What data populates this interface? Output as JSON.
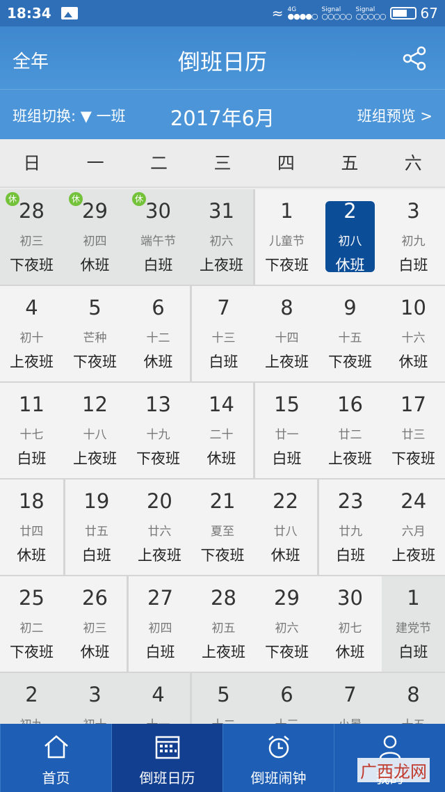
{
  "status_bar": {
    "time": "18:34",
    "network": "4G",
    "signal1": "Signal",
    "signal2": "Signal",
    "battery": "67"
  },
  "header": {
    "year_label": "全年",
    "title": "倒班日历"
  },
  "subheader": {
    "switch_label": "班组切换:",
    "team_arrow": "▼",
    "team": "一班",
    "month": "2017年6月",
    "preview_label": "班组预览",
    "preview_arrow": ">"
  },
  "weekdays": [
    "日",
    "一",
    "二",
    "三",
    "四",
    "五",
    "六"
  ],
  "weeks": [
    [
      {
        "day": "28",
        "lunar": "初三",
        "shift": "下夜班",
        "badge": "休",
        "gray": true
      },
      {
        "day": "29",
        "lunar": "初四",
        "shift": "休班",
        "badge": "休",
        "gray": true
      },
      {
        "day": "30",
        "lunar": "端午节",
        "shift": "白班",
        "badge": "休",
        "gray": true
      },
      {
        "day": "31",
        "lunar": "初六",
        "shift": "上夜班",
        "badge": "",
        "gray": true
      },
      {
        "day": "1",
        "lunar": "儿童节",
        "shift": "下夜班",
        "badge": ""
      },
      {
        "day": "2",
        "lunar": "初八",
        "shift": "休班",
        "badge": "",
        "selected": true
      },
      {
        "day": "3",
        "lunar": "初九",
        "shift": "白班",
        "badge": ""
      }
    ],
    [
      {
        "day": "4",
        "lunar": "初十",
        "shift": "上夜班"
      },
      {
        "day": "5",
        "lunar": "芒种",
        "shift": "下夜班"
      },
      {
        "day": "6",
        "lunar": "十二",
        "shift": "休班"
      },
      {
        "day": "7",
        "lunar": "十三",
        "shift": "白班"
      },
      {
        "day": "8",
        "lunar": "十四",
        "shift": "上夜班"
      },
      {
        "day": "9",
        "lunar": "十五",
        "shift": "下夜班"
      },
      {
        "day": "10",
        "lunar": "十六",
        "shift": "休班"
      }
    ],
    [
      {
        "day": "11",
        "lunar": "十七",
        "shift": "白班"
      },
      {
        "day": "12",
        "lunar": "十八",
        "shift": "上夜班"
      },
      {
        "day": "13",
        "lunar": "十九",
        "shift": "下夜班"
      },
      {
        "day": "14",
        "lunar": "二十",
        "shift": "休班"
      },
      {
        "day": "15",
        "lunar": "廿一",
        "shift": "白班"
      },
      {
        "day": "16",
        "lunar": "廿二",
        "shift": "上夜班"
      },
      {
        "day": "17",
        "lunar": "廿三",
        "shift": "下夜班"
      }
    ],
    [
      {
        "day": "18",
        "lunar": "廿四",
        "shift": "休班"
      },
      {
        "day": "19",
        "lunar": "廿五",
        "shift": "白班"
      },
      {
        "day": "20",
        "lunar": "廿六",
        "shift": "上夜班"
      },
      {
        "day": "21",
        "lunar": "夏至",
        "shift": "下夜班"
      },
      {
        "day": "22",
        "lunar": "廿八",
        "shift": "休班"
      },
      {
        "day": "23",
        "lunar": "廿九",
        "shift": "白班"
      },
      {
        "day": "24",
        "lunar": "六月",
        "shift": "上夜班"
      }
    ],
    [
      {
        "day": "25",
        "lunar": "初二",
        "shift": "下夜班"
      },
      {
        "day": "26",
        "lunar": "初三",
        "shift": "休班"
      },
      {
        "day": "27",
        "lunar": "初四",
        "shift": "白班"
      },
      {
        "day": "28",
        "lunar": "初五",
        "shift": "上夜班"
      },
      {
        "day": "29",
        "lunar": "初六",
        "shift": "下夜班"
      },
      {
        "day": "30",
        "lunar": "初七",
        "shift": "休班"
      },
      {
        "day": "1",
        "lunar": "建党节",
        "shift": "白班",
        "gray": true
      }
    ],
    [
      {
        "day": "2",
        "lunar": "初九",
        "shift": "",
        "gray": true
      },
      {
        "day": "3",
        "lunar": "初十",
        "shift": "",
        "gray": true
      },
      {
        "day": "4",
        "lunar": "十一",
        "shift": "",
        "gray": true
      },
      {
        "day": "5",
        "lunar": "十二",
        "shift": "",
        "gray": true
      },
      {
        "day": "6",
        "lunar": "十三",
        "shift": "",
        "gray": true
      },
      {
        "day": "7",
        "lunar": "小暑",
        "shift": "",
        "gray": true
      },
      {
        "day": "8",
        "lunar": "十五",
        "shift": "",
        "gray": true
      }
    ]
  ],
  "tabs": [
    {
      "label": "首页",
      "icon": "home-icon"
    },
    {
      "label": "倒班日历",
      "icon": "calendar-icon",
      "active": true
    },
    {
      "label": "倒班闹钟",
      "icon": "alarm-clock-icon"
    },
    {
      "label": "我的",
      "icon": "user-icon"
    }
  ],
  "watermark": "广西龙网"
}
